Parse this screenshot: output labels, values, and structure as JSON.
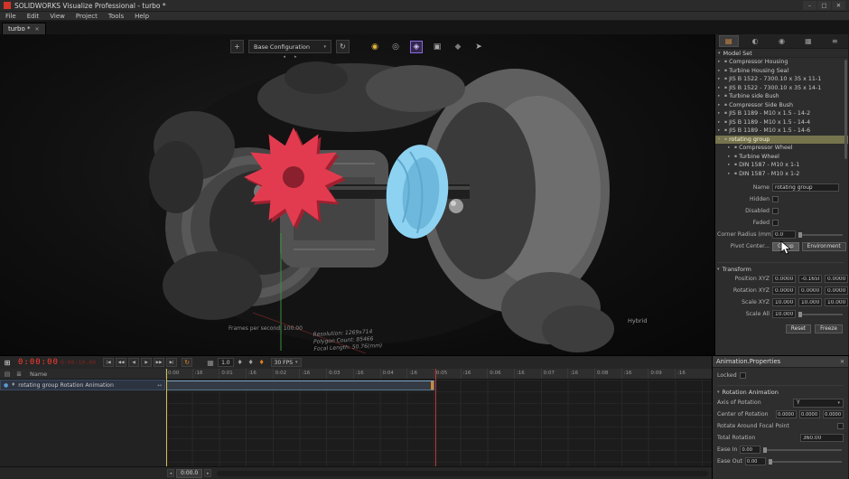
{
  "titlebar": {
    "title": "SOLIDWORKS Visualize Professional - turbo *"
  },
  "menubar": {
    "items": [
      "File",
      "Edit",
      "View",
      "Project",
      "Tools",
      "Help"
    ]
  },
  "tabbar": {
    "tab": "turbo *"
  },
  "viewport": {
    "config": "Base Configuration",
    "stats": {
      "fps": "Frames per second: 100.00",
      "resolution": "Resolution: 1269x714",
      "polygons": "Polygon Count: 85466",
      "focal": "Focal Length: 50.76(mm)"
    },
    "mode": "Hybrid"
  },
  "sidebar": {
    "root": "Model Set",
    "items": [
      "Compressor Housing",
      "Turbine Housing Seal",
      "JIS B 1522 - 7300.10 x 35 x 11-1",
      "JIS B 1522 - 7300.10 x 35 x 14-1",
      "Turbine side Bush",
      "Compressor Side Bush",
      "JIS B 1189 - M10 x 1.5 - 14-2",
      "JIS B 1189 - M10 x 1.5 - 14-4",
      "JIS B 1189 - M10 x 1.5 - 14-6",
      "rotating group",
      "Compressor Wheel",
      "Turbine Wheel",
      "DIN 1587 - M10 x 1-1",
      "DIN 1587 - M10 x 1-2"
    ],
    "props": {
      "name_label": "Name",
      "name_value": "rotating group",
      "hidden": "Hidden",
      "disabled": "Disabled",
      "faded": "Faded",
      "corner_label": "Corner Radius (mm)",
      "corner_value": "0.0",
      "pivot_label": "Pivot Center...",
      "group_btn": "Group",
      "environment_btn": "Environment",
      "transform": "Transform",
      "position_label": "Position XYZ",
      "position": [
        "0.0000",
        "-0.1658",
        "0.0000"
      ],
      "rotation_label": "Rotation XYZ",
      "rotation": [
        "0.0000",
        "0.0000",
        "0.0000"
      ],
      "scale_label": "Scale XYZ",
      "scale": [
        "10.0000",
        "10.0000",
        "10.0000"
      ],
      "scale_all_label": "Scale All",
      "scale_all": "10.0000",
      "reset_btn": "Reset",
      "freeze_btn": "Freeze"
    }
  },
  "timeline": {
    "time_current": "0:00:00",
    "time_total": "0:00:10.00",
    "speed": "1.0",
    "fps": "30 FPS",
    "name_header": "Name",
    "track": "rotating group Rotation Animation",
    "ruler": [
      "0:00",
      ":16",
      "0:01",
      ":16",
      "0:02",
      ":16",
      "0:03",
      ":16",
      "0:04",
      ":16",
      "0:05",
      ":16",
      "0:06",
      ":16",
      "0:07",
      ":16",
      "0:08",
      ":16",
      "0:09",
      ":16"
    ],
    "scroll_value": "0:00.0"
  },
  "anim": {
    "title": "Animation.Properties",
    "locked": "Locked",
    "section": "Rotation Animation",
    "axis_label": "Axis of Rotation",
    "axis_value": "Y",
    "center_label": "Center of Rotation",
    "center": [
      "0.0000",
      "0.0000",
      "0.0000"
    ],
    "rafp": "Rotate Around Focal Point",
    "total_label": "Total Rotation",
    "total_value": "360.00",
    "ease_in_label": "Ease In",
    "ease_in_value": "0.00",
    "ease_out_label": "Ease Out",
    "ease_out_value": "0.00"
  },
  "icons": {
    "minimize": "–",
    "maximize": "□",
    "close": "✕",
    "chevron_down": "▾",
    "chevron_right": "▸",
    "chevron_left": "◂",
    "plus": "+",
    "refresh": "↻",
    "bulb": "◉",
    "turntable": "◎",
    "magnet": "◈",
    "cube": "▣",
    "helmet": "◆",
    "pointer": "➤",
    "tab_models": "▤",
    "tab_appearances": "◐",
    "tab_environments": "◉",
    "tab_cameras": "▦",
    "tab_options": "≡",
    "part": "▪",
    "grid": "⊞",
    "list": "▤",
    "list2": "≣",
    "skip_start": "|◀",
    "step_back": "◀◀",
    "play_back": "◀",
    "play": "▶",
    "step_fwd": "▶▶",
    "skip_end": "▶|",
    "loop": "↻",
    "film": "▦",
    "key": "♦",
    "eye": "●",
    "arrows": "↔"
  },
  "colors": {
    "selection": "#75744d",
    "timecode": "#ff3a2e",
    "playhead_marker": "#c03535",
    "playhead_current": "#d2c152",
    "clip_border": "#56788f",
    "compressor_wheel": "#e23b4f",
    "turbine_wheel": "#8ed2f2"
  }
}
